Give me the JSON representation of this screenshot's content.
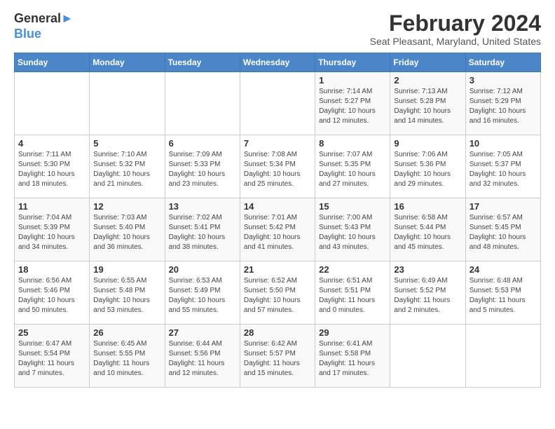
{
  "header": {
    "logo_line1": "General",
    "logo_line2": "Blue",
    "title": "February 2024",
    "subtitle": "Seat Pleasant, Maryland, United States"
  },
  "days_of_week": [
    "Sunday",
    "Monday",
    "Tuesday",
    "Wednesday",
    "Thursday",
    "Friday",
    "Saturday"
  ],
  "weeks": [
    [
      {
        "day": "",
        "info": ""
      },
      {
        "day": "",
        "info": ""
      },
      {
        "day": "",
        "info": ""
      },
      {
        "day": "",
        "info": ""
      },
      {
        "day": "1",
        "info": "Sunrise: 7:14 AM\nSunset: 5:27 PM\nDaylight: 10 hours\nand 12 minutes."
      },
      {
        "day": "2",
        "info": "Sunrise: 7:13 AM\nSunset: 5:28 PM\nDaylight: 10 hours\nand 14 minutes."
      },
      {
        "day": "3",
        "info": "Sunrise: 7:12 AM\nSunset: 5:29 PM\nDaylight: 10 hours\nand 16 minutes."
      }
    ],
    [
      {
        "day": "4",
        "info": "Sunrise: 7:11 AM\nSunset: 5:30 PM\nDaylight: 10 hours\nand 18 minutes."
      },
      {
        "day": "5",
        "info": "Sunrise: 7:10 AM\nSunset: 5:32 PM\nDaylight: 10 hours\nand 21 minutes."
      },
      {
        "day": "6",
        "info": "Sunrise: 7:09 AM\nSunset: 5:33 PM\nDaylight: 10 hours\nand 23 minutes."
      },
      {
        "day": "7",
        "info": "Sunrise: 7:08 AM\nSunset: 5:34 PM\nDaylight: 10 hours\nand 25 minutes."
      },
      {
        "day": "8",
        "info": "Sunrise: 7:07 AM\nSunset: 5:35 PM\nDaylight: 10 hours\nand 27 minutes."
      },
      {
        "day": "9",
        "info": "Sunrise: 7:06 AM\nSunset: 5:36 PM\nDaylight: 10 hours\nand 29 minutes."
      },
      {
        "day": "10",
        "info": "Sunrise: 7:05 AM\nSunset: 5:37 PM\nDaylight: 10 hours\nand 32 minutes."
      }
    ],
    [
      {
        "day": "11",
        "info": "Sunrise: 7:04 AM\nSunset: 5:39 PM\nDaylight: 10 hours\nand 34 minutes."
      },
      {
        "day": "12",
        "info": "Sunrise: 7:03 AM\nSunset: 5:40 PM\nDaylight: 10 hours\nand 36 minutes."
      },
      {
        "day": "13",
        "info": "Sunrise: 7:02 AM\nSunset: 5:41 PM\nDaylight: 10 hours\nand 38 minutes."
      },
      {
        "day": "14",
        "info": "Sunrise: 7:01 AM\nSunset: 5:42 PM\nDaylight: 10 hours\nand 41 minutes."
      },
      {
        "day": "15",
        "info": "Sunrise: 7:00 AM\nSunset: 5:43 PM\nDaylight: 10 hours\nand 43 minutes."
      },
      {
        "day": "16",
        "info": "Sunrise: 6:58 AM\nSunset: 5:44 PM\nDaylight: 10 hours\nand 45 minutes."
      },
      {
        "day": "17",
        "info": "Sunrise: 6:57 AM\nSunset: 5:45 PM\nDaylight: 10 hours\nand 48 minutes."
      }
    ],
    [
      {
        "day": "18",
        "info": "Sunrise: 6:56 AM\nSunset: 5:46 PM\nDaylight: 10 hours\nand 50 minutes."
      },
      {
        "day": "19",
        "info": "Sunrise: 6:55 AM\nSunset: 5:48 PM\nDaylight: 10 hours\nand 53 minutes."
      },
      {
        "day": "20",
        "info": "Sunrise: 6:53 AM\nSunset: 5:49 PM\nDaylight: 10 hours\nand 55 minutes."
      },
      {
        "day": "21",
        "info": "Sunrise: 6:52 AM\nSunset: 5:50 PM\nDaylight: 10 hours\nand 57 minutes."
      },
      {
        "day": "22",
        "info": "Sunrise: 6:51 AM\nSunset: 5:51 PM\nDaylight: 11 hours\nand 0 minutes."
      },
      {
        "day": "23",
        "info": "Sunrise: 6:49 AM\nSunset: 5:52 PM\nDaylight: 11 hours\nand 2 minutes."
      },
      {
        "day": "24",
        "info": "Sunrise: 6:48 AM\nSunset: 5:53 PM\nDaylight: 11 hours\nand 5 minutes."
      }
    ],
    [
      {
        "day": "25",
        "info": "Sunrise: 6:47 AM\nSunset: 5:54 PM\nDaylight: 11 hours\nand 7 minutes."
      },
      {
        "day": "26",
        "info": "Sunrise: 6:45 AM\nSunset: 5:55 PM\nDaylight: 11 hours\nand 10 minutes."
      },
      {
        "day": "27",
        "info": "Sunrise: 6:44 AM\nSunset: 5:56 PM\nDaylight: 11 hours\nand 12 minutes."
      },
      {
        "day": "28",
        "info": "Sunrise: 6:42 AM\nSunset: 5:57 PM\nDaylight: 11 hours\nand 15 minutes."
      },
      {
        "day": "29",
        "info": "Sunrise: 6:41 AM\nSunset: 5:58 PM\nDaylight: 11 hours\nand 17 minutes."
      },
      {
        "day": "",
        "info": ""
      },
      {
        "day": "",
        "info": ""
      }
    ]
  ]
}
